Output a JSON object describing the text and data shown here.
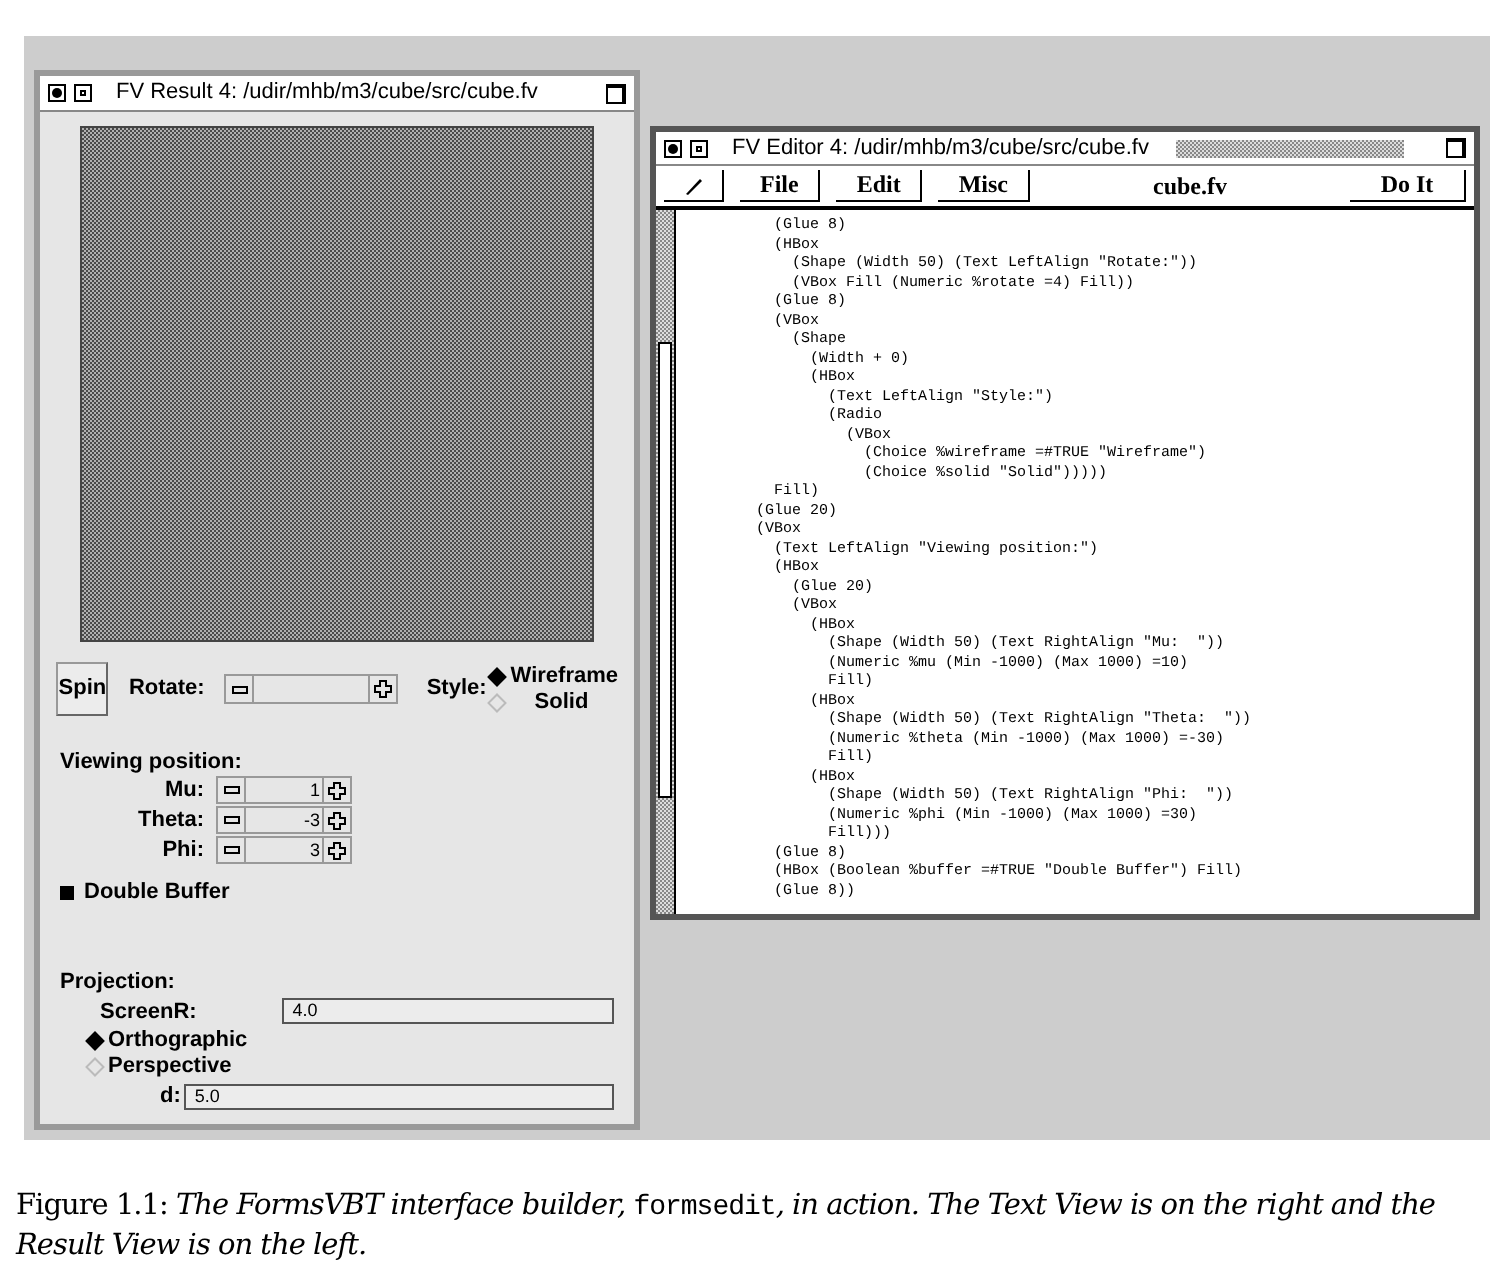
{
  "result_window": {
    "title": "FV Result 4: /udir/mhb/m3/cube/src/cube.fv",
    "spin_button": "Spin",
    "rotate": {
      "label": "Rotate:"
    },
    "style": {
      "label": "Style:",
      "options": [
        {
          "label": "Wireframe",
          "selected": true
        },
        {
          "label": "Solid",
          "selected": false
        }
      ]
    },
    "viewing": {
      "label": "Viewing position:",
      "fields": [
        {
          "label": "Mu:",
          "value": "1"
        },
        {
          "label": "Theta:",
          "value": "-3"
        },
        {
          "label": "Phi:",
          "value": "3"
        }
      ]
    },
    "double_buffer": {
      "label": "Double Buffer",
      "checked": true
    },
    "projection": {
      "label": "Projection:",
      "screen_r": {
        "label": "ScreenR:",
        "value": "4.0"
      },
      "options": [
        {
          "label": "Orthographic",
          "selected": true
        },
        {
          "label": "Perspective",
          "selected": false
        }
      ],
      "d": {
        "label": "d:",
        "value": "5.0"
      }
    }
  },
  "editor_window": {
    "title": "FV Editor 4: /udir/mhb/m3/cube/src/cube.fv",
    "menus": [
      "File",
      "Edit",
      "Misc"
    ],
    "filename": "cube.fv",
    "do_it": "Do It",
    "code": [
      "          (Glue 8)",
      "          (HBox",
      "            (Shape (Width 50) (Text LeftAlign \"Rotate:\"))",
      "            (VBox Fill (Numeric %rotate =4) Fill))",
      "          (Glue 8)",
      "          (VBox",
      "            (Shape",
      "              (Width + 0)",
      "              (HBox",
      "                (Text LeftAlign \"Style:\")",
      "                (Radio",
      "                  (VBox",
      "                    (Choice %wireframe =#TRUE \"Wireframe\")",
      "                    (Choice %solid \"Solid\")))))",
      "          Fill)",
      "        (Glue 20)",
      "        (VBox",
      "          (Text LeftAlign \"Viewing position:\")",
      "          (HBox",
      "            (Glue 20)",
      "            (VBox",
      "              (HBox",
      "                (Shape (Width 50) (Text RightAlign \"Mu:  \"))",
      "                (Numeric %mu (Min -1000) (Max 1000) =10)",
      "                Fill)",
      "              (HBox",
      "                (Shape (Width 50) (Text RightAlign \"Theta:  \"))",
      "                (Numeric %theta (Min -1000) (Max 1000) =-30)",
      "                Fill)",
      "              (HBox",
      "                (Shape (Width 50) (Text RightAlign \"Phi:  \"))",
      "                (Numeric %phi (Min -1000) (Max 1000) =30)",
      "                Fill)))",
      "          (Glue 8)",
      "          (HBox (Boolean %buffer =#TRUE \"Double Buffer\") Fill)",
      "          (Glue 8))"
    ]
  },
  "caption": [
    {
      "kind": "plain",
      "text": "Figure 1.1: "
    },
    {
      "kind": "italic",
      "text": "The FormsVBT interface builder, "
    },
    {
      "kind": "code",
      "text": "formsedit"
    },
    {
      "kind": "italic",
      "text": ", in action. The Text View is on the right and the Result View is on the left."
    }
  ]
}
